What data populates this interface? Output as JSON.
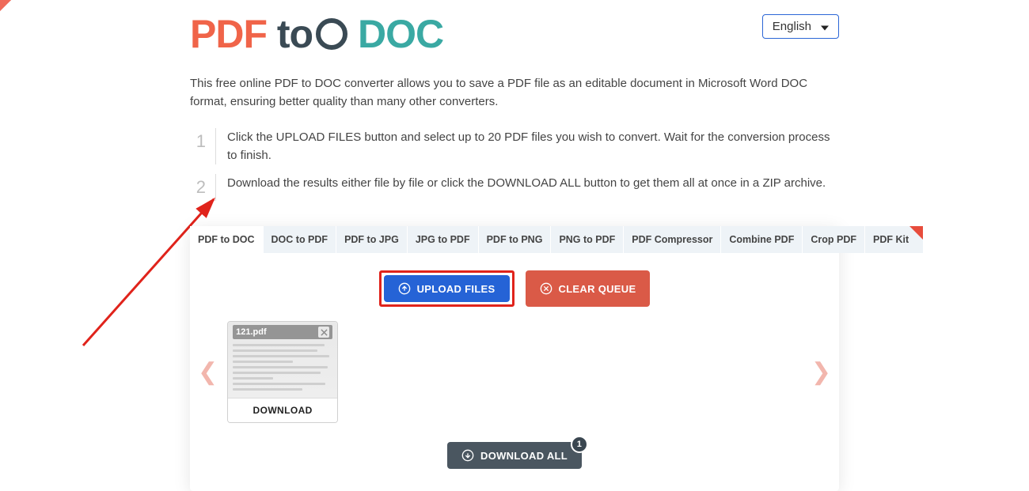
{
  "lang": {
    "selected": "English"
  },
  "logo": {
    "p1": "PDF",
    "p2": "to",
    "p3": "DOC"
  },
  "intro": "This free online PDF to DOC converter allows you to save a PDF file as an editable document in Microsoft Word DOC format, ensuring better quality than many other converters.",
  "steps": [
    "Click the UPLOAD FILES button and select up to 20 PDF files you wish to convert. Wait for the conversion process to finish.",
    "Download the results either file by file or click the DOWNLOAD ALL button to get them all at once in a ZIP archive."
  ],
  "tabs": {
    "items": [
      "PDF to DOC",
      "DOC to PDF",
      "PDF to JPG",
      "JPG to PDF",
      "PDF to PNG",
      "PNG to PDF",
      "PDF Compressor",
      "Combine PDF",
      "Crop PDF"
    ],
    "kit": "PDF Kit",
    "active_index": 0
  },
  "buttons": {
    "upload": "UPLOAD FILES",
    "clear": "CLEAR QUEUE",
    "download_all": "DOWNLOAD ALL",
    "download": "DOWNLOAD"
  },
  "files": [
    {
      "name": "121.pdf"
    }
  ],
  "badge_count": "1"
}
